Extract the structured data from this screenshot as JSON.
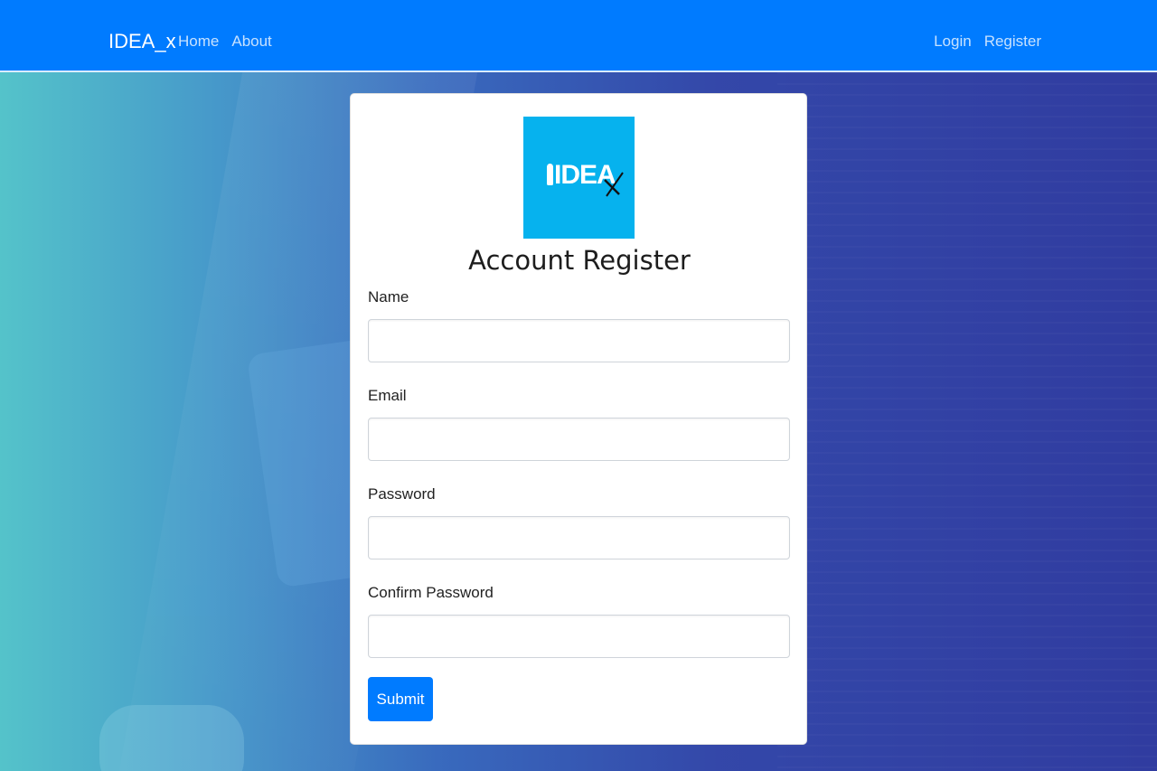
{
  "navbar": {
    "brand": "IDEA_x",
    "left_links": [
      "Home",
      "About"
    ],
    "right_links": [
      "Login",
      "Register"
    ],
    "color": "#007bff"
  },
  "card": {
    "logo": {
      "text": "IDEA",
      "mark": "x",
      "bg_color": "#06b2ee"
    },
    "title": "Account Register",
    "fields": [
      {
        "label": "Name",
        "value": "",
        "placeholder": ""
      },
      {
        "label": "Email",
        "value": "",
        "placeholder": ""
      },
      {
        "label": "Password",
        "value": "",
        "placeholder": ""
      },
      {
        "label": "Confirm Password",
        "value": "",
        "placeholder": ""
      }
    ],
    "submit_label": "Submit"
  }
}
